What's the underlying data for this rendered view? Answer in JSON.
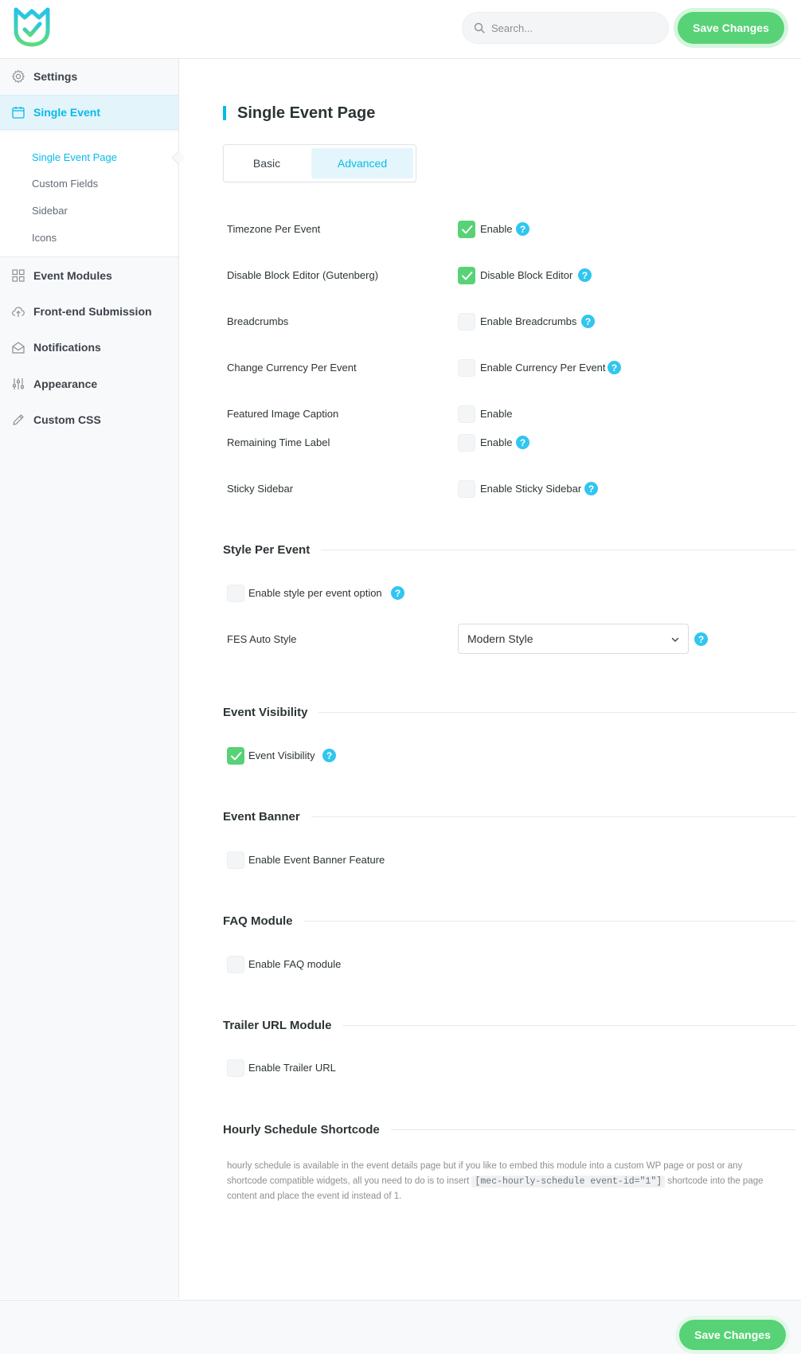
{
  "header": {
    "search_placeholder": "Search...",
    "save_label": "Save Changes"
  },
  "sidebar": {
    "items": [
      {
        "label": "Settings",
        "icon": "gear-icon"
      },
      {
        "label": "Single Event",
        "icon": "calendar-icon",
        "active": true
      },
      {
        "label": "Event Modules",
        "icon": "grid-icon"
      },
      {
        "label": "Front-end Submission",
        "icon": "cloud-upload-icon"
      },
      {
        "label": "Notifications",
        "icon": "envelope-icon"
      },
      {
        "label": "Appearance",
        "icon": "sliders-icon"
      },
      {
        "label": "Custom CSS",
        "icon": "pencil-icon"
      }
    ],
    "sub_items": [
      {
        "label": "Single Event Page",
        "active": true
      },
      {
        "label": "Custom Fields"
      },
      {
        "label": "Sidebar"
      },
      {
        "label": "Icons"
      }
    ]
  },
  "main": {
    "title": "Single Event Page",
    "tabs": [
      {
        "label": "Basic"
      },
      {
        "label": "Advanced",
        "active": true
      }
    ],
    "settings": [
      {
        "label": "Timezone Per Event",
        "checkbox_label": "Enable",
        "checked": true,
        "help": true
      },
      {
        "label": "Disable Block Editor (Gutenberg)",
        "checkbox_label": "Disable Block Editor",
        "checked": true,
        "help": true
      },
      {
        "label": "Breadcrumbs",
        "checkbox_label": "Enable Breadcrumbs",
        "checked": false,
        "help": true
      },
      {
        "label": "Change Currency Per Event",
        "checkbox_label": "Enable Currency Per Event",
        "checked": false,
        "help": true
      },
      {
        "label": "Featured Image Caption",
        "checkbox_label": "Enable",
        "checked": false,
        "help": false
      },
      {
        "label": "Remaining Time Label",
        "checkbox_label": "Enable",
        "checked": false,
        "help": true
      },
      {
        "label": "Sticky Sidebar",
        "checkbox_label": "Enable Sticky Sidebar",
        "checked": false,
        "help": true
      }
    ],
    "style_per_event": {
      "title": "Style Per Event",
      "checkbox_label": "Enable style per event option",
      "checked": false,
      "fes_label": "FES Auto Style",
      "fes_value": "Modern Style"
    },
    "event_visibility": {
      "title": "Event Visibility",
      "checkbox_label": "Event Visibility",
      "checked": true
    },
    "event_banner": {
      "title": "Event Banner",
      "checkbox_label": "Enable Event Banner Feature",
      "checked": false
    },
    "faq": {
      "title": "FAQ Module",
      "checkbox_label": "Enable FAQ module",
      "checked": false
    },
    "trailer": {
      "title": "Trailer URL Module",
      "checkbox_label": "Enable Trailer URL",
      "checked": false
    },
    "hourly": {
      "title": "Hourly Schedule Shortcode",
      "desc_before": "hourly schedule is available in the event details page but if you like to embed this module into a custom WP page or post or any shortcode compatible widgets, all you need to do is to insert ",
      "shortcode": "[mec-hourly-schedule event-id=\"1\"]",
      "desc_after": " shortcode into the page content and place the event id instead of 1."
    }
  },
  "colors": {
    "accent": "#07bbe9",
    "success": "#57d276",
    "help": "#30c6f0"
  }
}
